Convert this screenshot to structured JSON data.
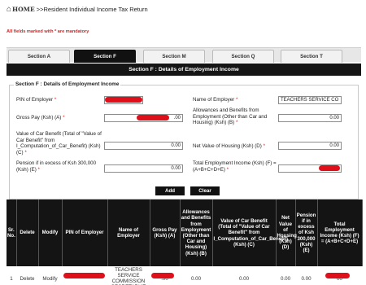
{
  "breadcrumb": {
    "home_label": "HOME",
    "trail": ">>Resident Individual Income Tax Return"
  },
  "mandatory_note": "All fields marked with * are mandatory",
  "tabs": [
    {
      "label": "Section A",
      "active": false
    },
    {
      "label": "Section F",
      "active": true
    },
    {
      "label": "Section M",
      "active": false
    },
    {
      "label": "Section Q",
      "active": false
    },
    {
      "label": "Section T",
      "active": false
    }
  ],
  "section_header": "Section F : Details of Employment Income",
  "form": {
    "legend": "Section F : Details of Employment Income",
    "pin_employer_label": "PIN of Employer",
    "pin_employer_value": "",
    "name_employer_label": "Name of Employer",
    "name_employer_value": "TEACHERS SERVICE CO",
    "gross_pay_label": "Gross Pay (Ksh) (A)",
    "gross_pay_value": ".00",
    "allowances_label": "Allowances and Benefits from Employment (Other than Car and Housing) (Ksh) (B)",
    "allowances_value": "0.00",
    "car_benefit_label": "Value of Car Benefit (Total of \"Value of Car Benefit\" from I_Computation_of_Car_Benefit) (Ksh) (C)",
    "car_benefit_value": "0.00",
    "housing_label": "Net Value of Housing (Ksh) (D)",
    "housing_value": "0.00",
    "pension_label": "Pension if in excess of Ksh 300,000 (Ksh) (E)",
    "pension_value": "0.00",
    "total_label": "Total Employment Income (Ksh) (F) = (A+B+C+D+E)",
    "total_value": "",
    "required_mark": "*"
  },
  "buttons": {
    "add": "Add",
    "clear": "Clear"
  },
  "table": {
    "headers": [
      "Sr. No.",
      "Delete",
      "Modify",
      "PIN of Employer",
      "Name of Employer",
      "Gross Pay (Ksh) (A)",
      "Allowances and Benefits from Employment (Other than Car and Housing) (Ksh) (B)",
      "Value of Car Benefit (Total of \"Value of Car Benefit\" from I_Computation_of_Car_Benefit) (Ksh) (C)",
      "Net Value of Housing (Ksh) (D)",
      "Pension if in excess of Ksh 300,000 (Ksh) (E)",
      "Total Employment Income (Ksh) (F) = (A+B+C+D+E)"
    ],
    "rows": [
      {
        "sr": "1",
        "delete": "Delete",
        "modify": "Modify",
        "pin": "",
        "name": "TEACHERS SERVICE COMMISSION SECRETARIAT",
        "gross": ".00",
        "allowances": "0.00",
        "car": "0.00",
        "housing": "0.00",
        "pension": "0.00",
        "total": "00"
      }
    ]
  },
  "colors": {
    "redaction": "#e0101a",
    "required": "#d81e1e",
    "header_bg": "#151515"
  }
}
